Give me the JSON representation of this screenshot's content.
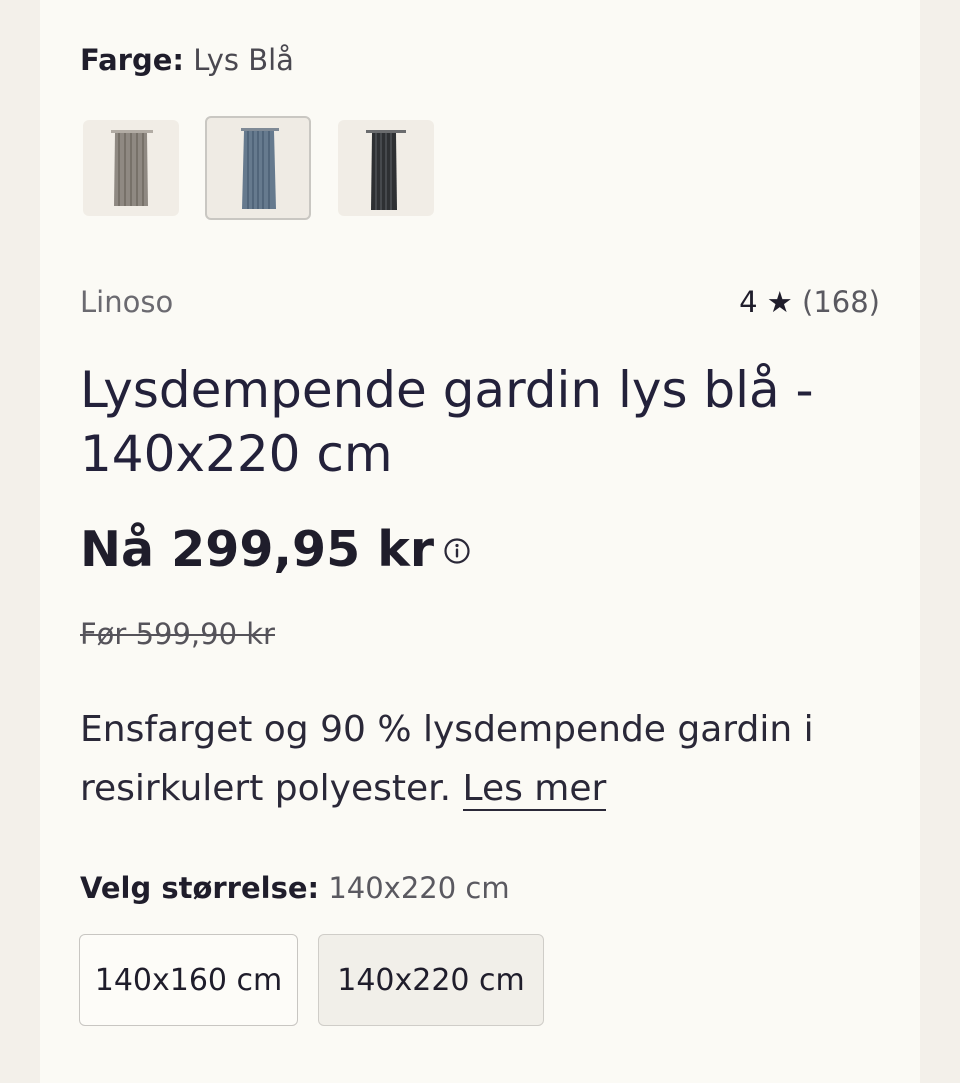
{
  "color": {
    "label": "Farge:",
    "value": "Lys Blå",
    "swatches": [
      {
        "name": "beige",
        "color": "#8b857e",
        "selected": false
      },
      {
        "name": "lys-bla",
        "color": "#64788c",
        "selected": true
      },
      {
        "name": "svart",
        "color": "#2c2e31",
        "selected": false
      }
    ]
  },
  "product": {
    "brand": "Linoso",
    "rating": {
      "score": "4",
      "star": "★",
      "count": "(168)"
    },
    "title": "Lysdempende gardin lys blå - 140x220 cm",
    "price": "Nå 299,95 kr",
    "old_price": "Før 599,90 kr",
    "description": "Ensfarget og 90 % lysdempende gardin i resirkulert polyester.",
    "read_more": "Les mer"
  },
  "size": {
    "label": "Velg størrelse:",
    "value": "140x220 cm",
    "options": [
      "140x160 cm",
      "140x220 cm"
    ],
    "selected_index": 1
  }
}
